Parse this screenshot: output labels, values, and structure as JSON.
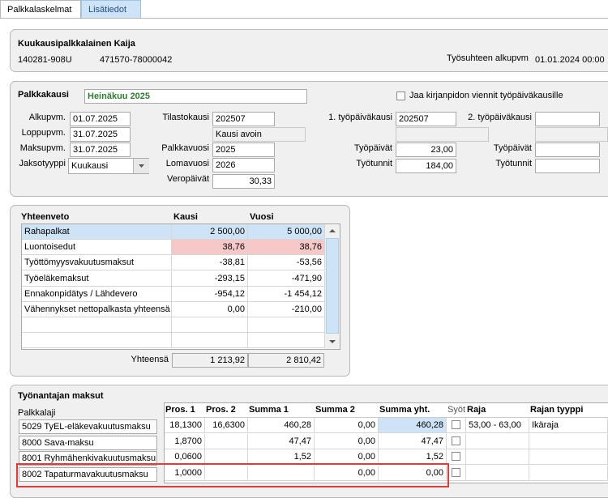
{
  "tabs": [
    {
      "label": "Palkkalaskelmat",
      "active": false
    },
    {
      "label": "Lisätiedot",
      "active": true
    }
  ],
  "employee": {
    "name": "Kuukausipalkkalainen Kaija",
    "ssn": "140281-908U",
    "account": "471570-78000042",
    "start_label": "Työsuhteen alkupvm",
    "start_value": "01.01.2024 00:00"
  },
  "period": {
    "palkkakausi_label": "Palkkakausi",
    "palkkakausi_value": "Heinäkuu 2025",
    "kirjanpito_label": "Jaa kirjanpidon viennit työpäiväkausille",
    "alkupvm_label": "Alkupvm.",
    "alkupvm_value": "01.07.2025",
    "loppupvm_label": "Loppupvm.",
    "loppupvm_value": "31.07.2025",
    "maksupvm_label": "Maksupvm.",
    "maksupvm_value": "31.07.2025",
    "jaksotyyppi_label": "Jaksotyyppi",
    "jaksotyyppi_value": "Kuukausi",
    "tilastokausi_label": "Tilastokausi",
    "tilastokausi_value": "202507",
    "kausi_status": "Kausi avoin",
    "palkkavuosi_label": "Palkkavuosi",
    "palkkavuosi_value": "2025",
    "lomavuosi_label": "Lomavuosi",
    "lomavuosi_value": "2026",
    "veropaivat_label": "Veropäivät",
    "veropaivat_value": "30,33",
    "tpk1_label": "1. työpäiväkausi",
    "tpk1_value": "202507",
    "tpk2_label": "2. työpäiväkausi",
    "tpk2_value": "",
    "tyopaivat_label": "Työpäivät",
    "tyopaivat1_value": "23,00",
    "tyopaivat2_value": "",
    "tyotunnit_label": "Työtunnit",
    "tyotunnit1_value": "184,00",
    "tyotunnit2_value": ""
  },
  "summary": {
    "title": "Yhteenveto",
    "col_kausi": "Kausi",
    "col_vuosi": "Vuosi",
    "rows": [
      {
        "name": "Rahapalkat",
        "kausi": "2 500,00",
        "vuosi": "5 000,00",
        "style": "selected"
      },
      {
        "name": "Luontoisedut",
        "kausi": "38,76",
        "vuosi": "38,76",
        "style": "pink"
      },
      {
        "name": "Työttömyysvakuutusmaksut",
        "kausi": "-38,81",
        "vuosi": "-53,56",
        "style": ""
      },
      {
        "name": "Työeläkemaksut",
        "kausi": "-293,15",
        "vuosi": "-471,90",
        "style": ""
      },
      {
        "name": "Ennakonpidätys / Lähdevero",
        "kausi": "-954,12",
        "vuosi": "-1 454,12",
        "style": ""
      },
      {
        "name": "Vähennykset nettopalkasta yhteensä",
        "kausi": "0,00",
        "vuosi": "-210,00",
        "style": ""
      },
      {
        "name": "",
        "kausi": "",
        "vuosi": "",
        "style": ""
      },
      {
        "name": "",
        "kausi": "",
        "vuosi": "",
        "style": ""
      }
    ],
    "total_label": "Yhteensä",
    "total_kausi": "1 213,92",
    "total_vuosi": "2 810,42"
  },
  "employer": {
    "title": "Työnantajan maksut",
    "palkkalaji_label": "Palkkalaji",
    "headers": [
      "Pros. 1",
      "Pros. 2",
      "Summa 1",
      "Summa 2",
      "Summa yht.",
      "Syöttö",
      "Raja",
      "Rajan tyyppi"
    ],
    "rows": [
      {
        "name": "5029 TyEL-eläkevakuutusmaksu",
        "pros1": "18,1300",
        "pros2": "16,6300",
        "summa1": "460,28",
        "summa2": "0,00",
        "summayht": "460,28",
        "raja": "53,00 - 63,00",
        "rajan_tyyppi": "Ikäraja"
      },
      {
        "name": "8000 Sava-maksu",
        "pros1": "1,8700",
        "pros2": "",
        "summa1": "47,47",
        "summa2": "0,00",
        "summayht": "47,47",
        "raja": "",
        "rajan_tyyppi": ""
      },
      {
        "name": "8001 Ryhmähenkivakuutusmaksu",
        "pros1": "0,0600",
        "pros2": "",
        "summa1": "1,52",
        "summa2": "0,00",
        "summayht": "1,52",
        "raja": "",
        "rajan_tyyppi": ""
      },
      {
        "name": "8002 Tapaturmavakuutusmaksu",
        "pros1": "1,0000",
        "pros2": "",
        "summa1": "",
        "summa2": "0,00",
        "summayht": "0,00",
        "raja": "",
        "rajan_tyyppi": ""
      }
    ]
  },
  "colors": {
    "selected_row": "#cfe3f6",
    "pink_row": "#f7c8c8",
    "palkkakausi_text": "#2e7d32",
    "highlight_border": "#e03c3c"
  },
  "icons": {
    "dropdown": "chevron-down-icon",
    "scroll_up": "arrow-up-icon",
    "scroll_down": "arrow-down-icon"
  }
}
